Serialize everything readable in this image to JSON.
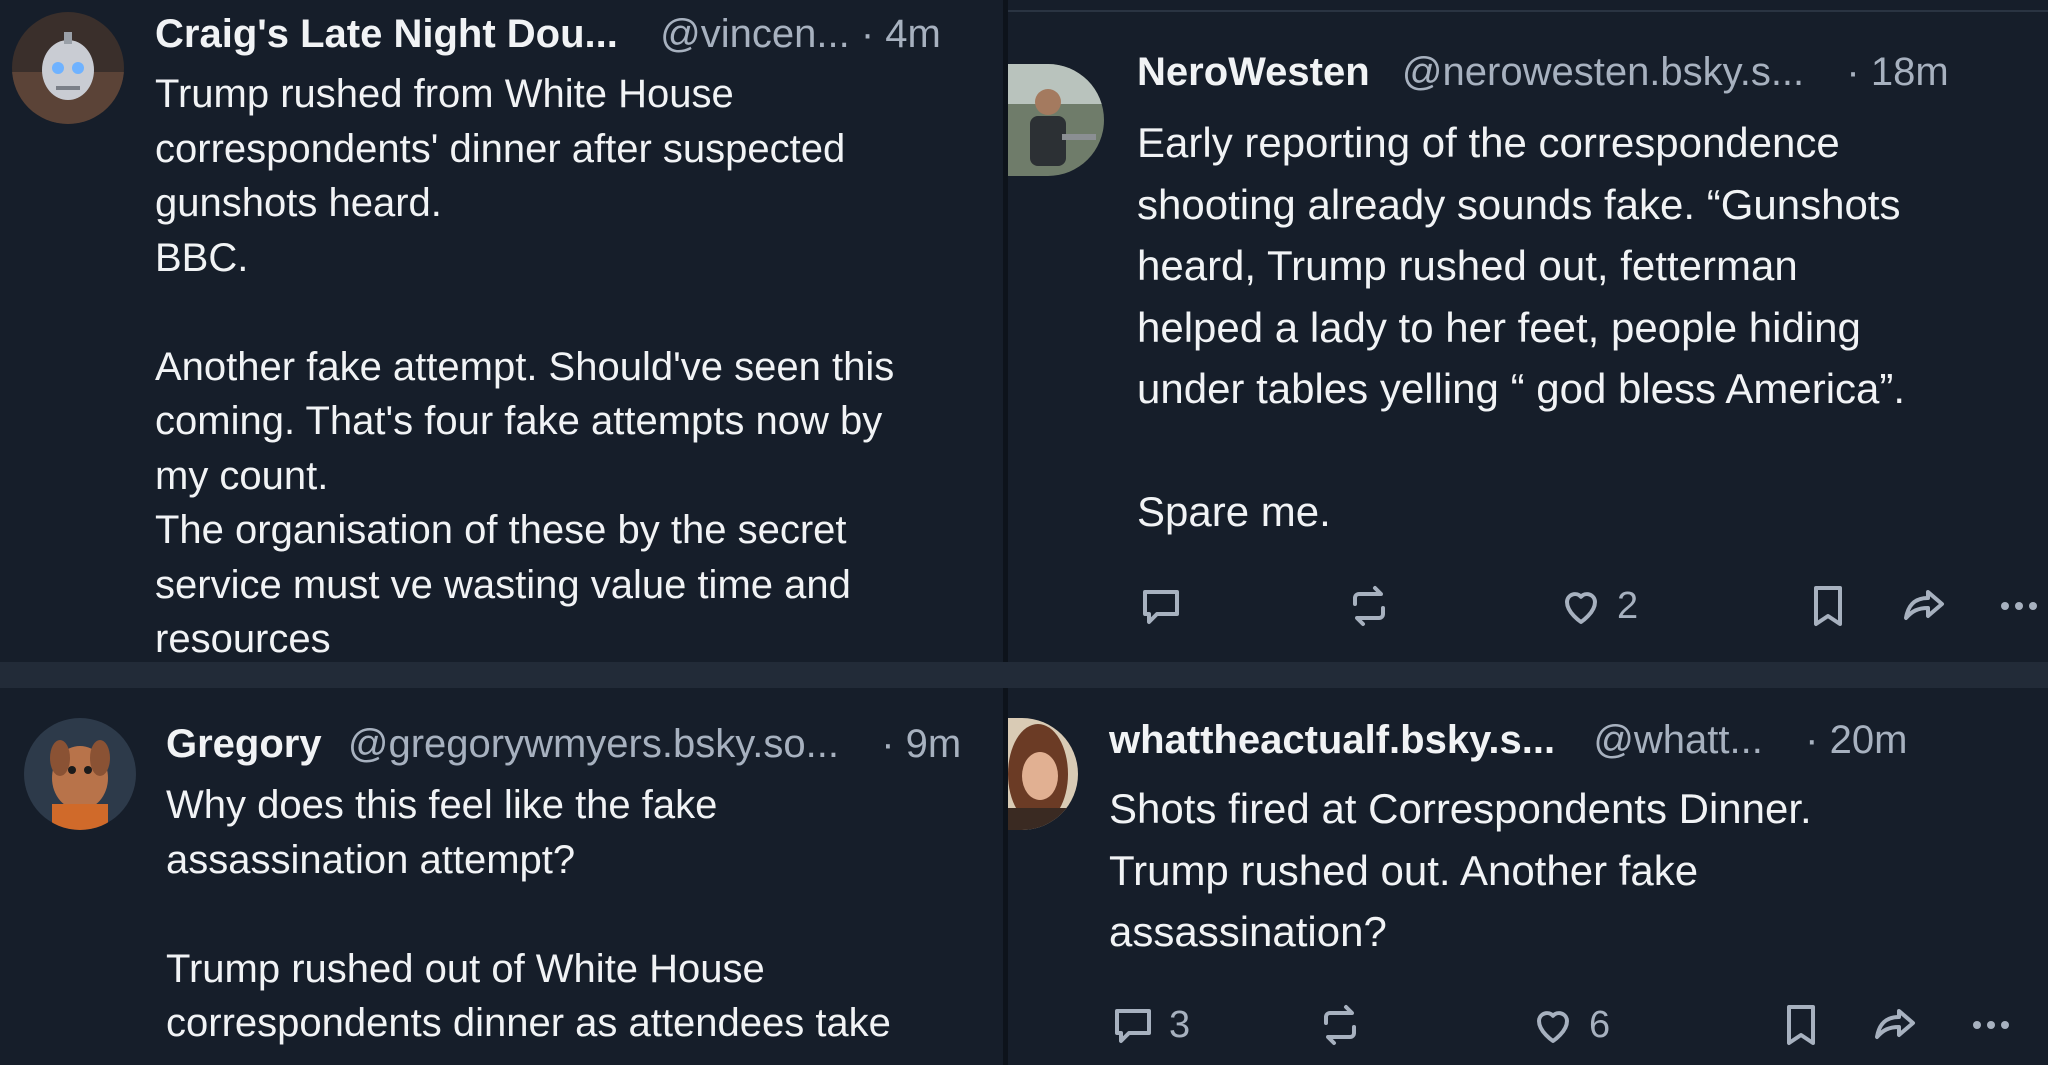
{
  "posts": [
    {
      "name": "Craig's Late Night Dou...",
      "handle": "@vincen...",
      "sep": "·",
      "time": "4m",
      "body": "Trump rushed from White House\ncorrespondents' dinner after suspected\ngunshots heard.\nBBC.\n\nAnother fake attempt. Should've seen this\ncoming. That's four fake attempts now by\nmy count.\nThe organisation of these by the secret\nservice must ve wasting value time and\nresources",
      "avatar_icon": "robot-avatar-icon"
    },
    {
      "name": "NeroWesten",
      "handle": "@nerowesten.bsky.s...",
      "sep": "·",
      "time": "18m",
      "body": "Early reporting of the correspondence\nshooting already sounds fake. “Gunshots\nheard, Trump rushed out, fetterman\nhelped a lady to her feet, people hiding\nunder tables yelling “ god bless America”.\n\nSpare me.",
      "avatar_icon": "person-photo-avatar-icon",
      "actions": {
        "reply_count": "",
        "repost_count": "",
        "like_count": "2"
      }
    },
    {
      "name": "Gregory",
      "handle": "@gregorywmyers.bsky.so...",
      "sep": "·",
      "time": "9m",
      "body": "Why does this feel like the fake\nassassination attempt?\n\nTrump rushed out of White House\ncorrespondents dinner as attendees take",
      "avatar_icon": "dog-avatar-icon"
    },
    {
      "name": "whattheactualf.bsky.s...",
      "handle": "@whatt...",
      "sep": "·",
      "time": "20m",
      "body": "Shots fired at Correspondents Dinner.\nTrump rushed out. Another fake\nassassination?",
      "avatar_icon": "woman-photo-avatar-icon",
      "actions": {
        "reply_count": "3",
        "repost_count": "",
        "like_count": "6"
      }
    }
  ],
  "icons": {
    "reply": "reply-icon",
    "repost": "repost-icon",
    "like": "heart-icon",
    "bookmark": "bookmark-icon",
    "share": "share-icon",
    "more": "more-icon"
  },
  "colors": {
    "background": "#161e2a",
    "text": "#f1f3f5",
    "muted": "#a7b1bf"
  }
}
